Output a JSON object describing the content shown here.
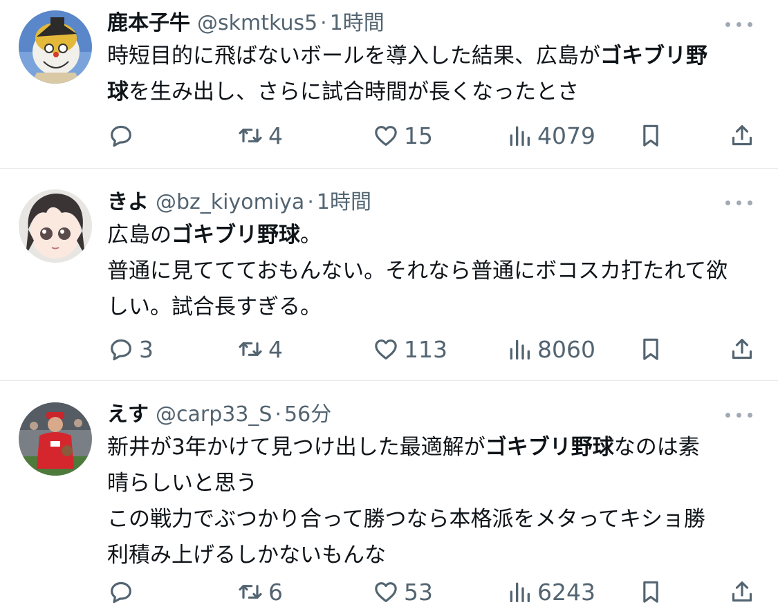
{
  "tweets": [
    {
      "name": "鹿本子牛",
      "handle": "@skmtkus5",
      "separator": "·",
      "time": "1時間",
      "lines": [
        {
          "pre": "時短目的に飛ばないボールを導入した結果、広島が",
          "bold": "ゴキブリ野",
          "post": ""
        },
        {
          "pre": "",
          "bold": "球",
          "post": "を生み出し、さらに試合時間が長くなったとさ"
        }
      ],
      "replies": "",
      "retweets": "4",
      "likes": "15",
      "views": "4079"
    },
    {
      "name": "きよ",
      "handle": "@bz_kiyomiya",
      "separator": "·",
      "time": "1時間",
      "lines": [
        {
          "pre": "広島の",
          "bold": "ゴキブリ野球",
          "post": "。"
        },
        {
          "pre": "普通に見ててておもんない。それなら普通にボコスカ打たれて欲",
          "bold": "",
          "post": ""
        },
        {
          "pre": "しい。試合長すぎる。",
          "bold": "",
          "post": ""
        }
      ],
      "replies": "3",
      "retweets": "4",
      "likes": "113",
      "views": "8060"
    },
    {
      "name": "えす",
      "handle": "@carp33_S",
      "separator": "·",
      "time": "56分",
      "lines": [
        {
          "pre": "新井が3年かけて見つけ出した最適解が",
          "bold": "ゴキブリ野球",
          "post": "なのは素"
        },
        {
          "pre": "晴らしいと思う",
          "bold": "",
          "post": ""
        },
        {
          "pre": "この戦力でぶつかり合って勝つなら本格派をメタってキショ勝",
          "bold": "",
          "post": ""
        },
        {
          "pre": "利積み上げるしかないもんな",
          "bold": "",
          "post": ""
        }
      ],
      "replies": "",
      "retweets": "6",
      "likes": "53",
      "views": "6243"
    }
  ],
  "icons": {
    "reply": "speech-bubble",
    "retweet": "repost-arrows",
    "like": "heart-outline",
    "views": "bar-chart",
    "bookmark": "bookmark-outline",
    "share": "share-arrow-up"
  },
  "colors": {
    "text": "#0f1419",
    "secondary": "#536471",
    "divider": "#e6e9ec"
  }
}
